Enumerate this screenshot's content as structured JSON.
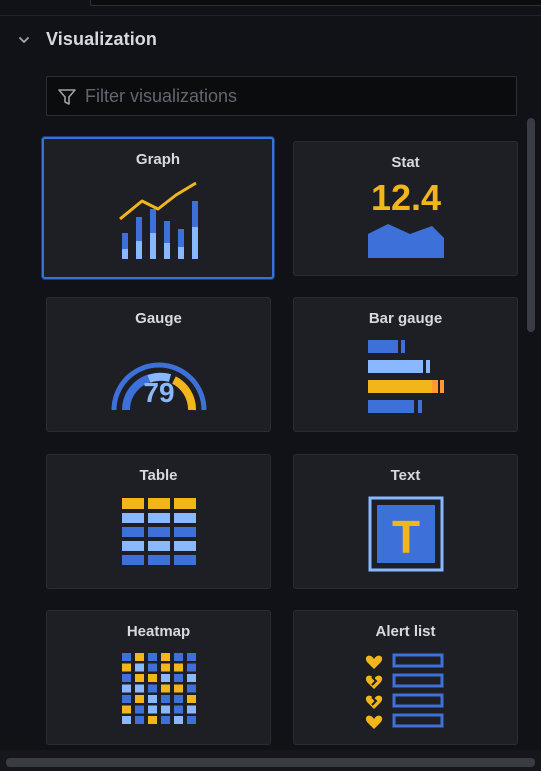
{
  "section": {
    "title": "Visualization"
  },
  "search": {
    "placeholder": "Filter visualizations",
    "value": ""
  },
  "visualizations": [
    {
      "label": "Graph",
      "selected": true,
      "icon": "graph-icon"
    },
    {
      "label": "Stat",
      "value_display": "12.4",
      "icon": "stat-icon"
    },
    {
      "label": "Gauge",
      "value_display": "79",
      "icon": "gauge-icon"
    },
    {
      "label": "Bar gauge",
      "icon": "bar-gauge-icon"
    },
    {
      "label": "Table",
      "icon": "table-icon"
    },
    {
      "label": "Text",
      "icon_letter": "T",
      "icon": "text-icon"
    },
    {
      "label": "Heatmap",
      "icon": "heatmap-icon"
    },
    {
      "label": "Alert list",
      "icon": "alert-list-icon"
    }
  ],
  "colors": {
    "accent_blue": "#3871dc",
    "light_blue": "#8ab8ff",
    "mid_blue": "#3d71d9",
    "yellow": "#fade2a",
    "orange": "#ff9830",
    "gold": "#f2b61a"
  }
}
